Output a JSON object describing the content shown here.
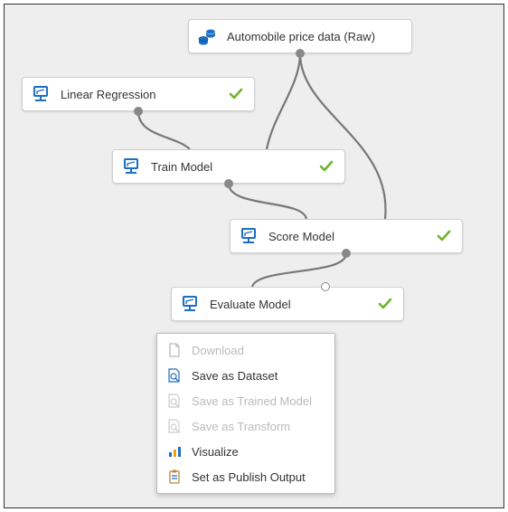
{
  "nodes": {
    "source": {
      "label": "Automobile price data (Raw)"
    },
    "linreg": {
      "label": "Linear Regression"
    },
    "train": {
      "label": "Train Model"
    },
    "score": {
      "label": "Score Model"
    },
    "evaluate": {
      "label": "Evaluate Model"
    }
  },
  "context_menu": {
    "download": {
      "label": "Download"
    },
    "save_dataset": {
      "label": "Save as Dataset"
    },
    "save_trained": {
      "label": "Save as Trained Model"
    },
    "save_transform": {
      "label": "Save as Transform"
    },
    "visualize": {
      "label": "Visualize"
    },
    "publish_output": {
      "label": "Set as Publish Output"
    }
  }
}
